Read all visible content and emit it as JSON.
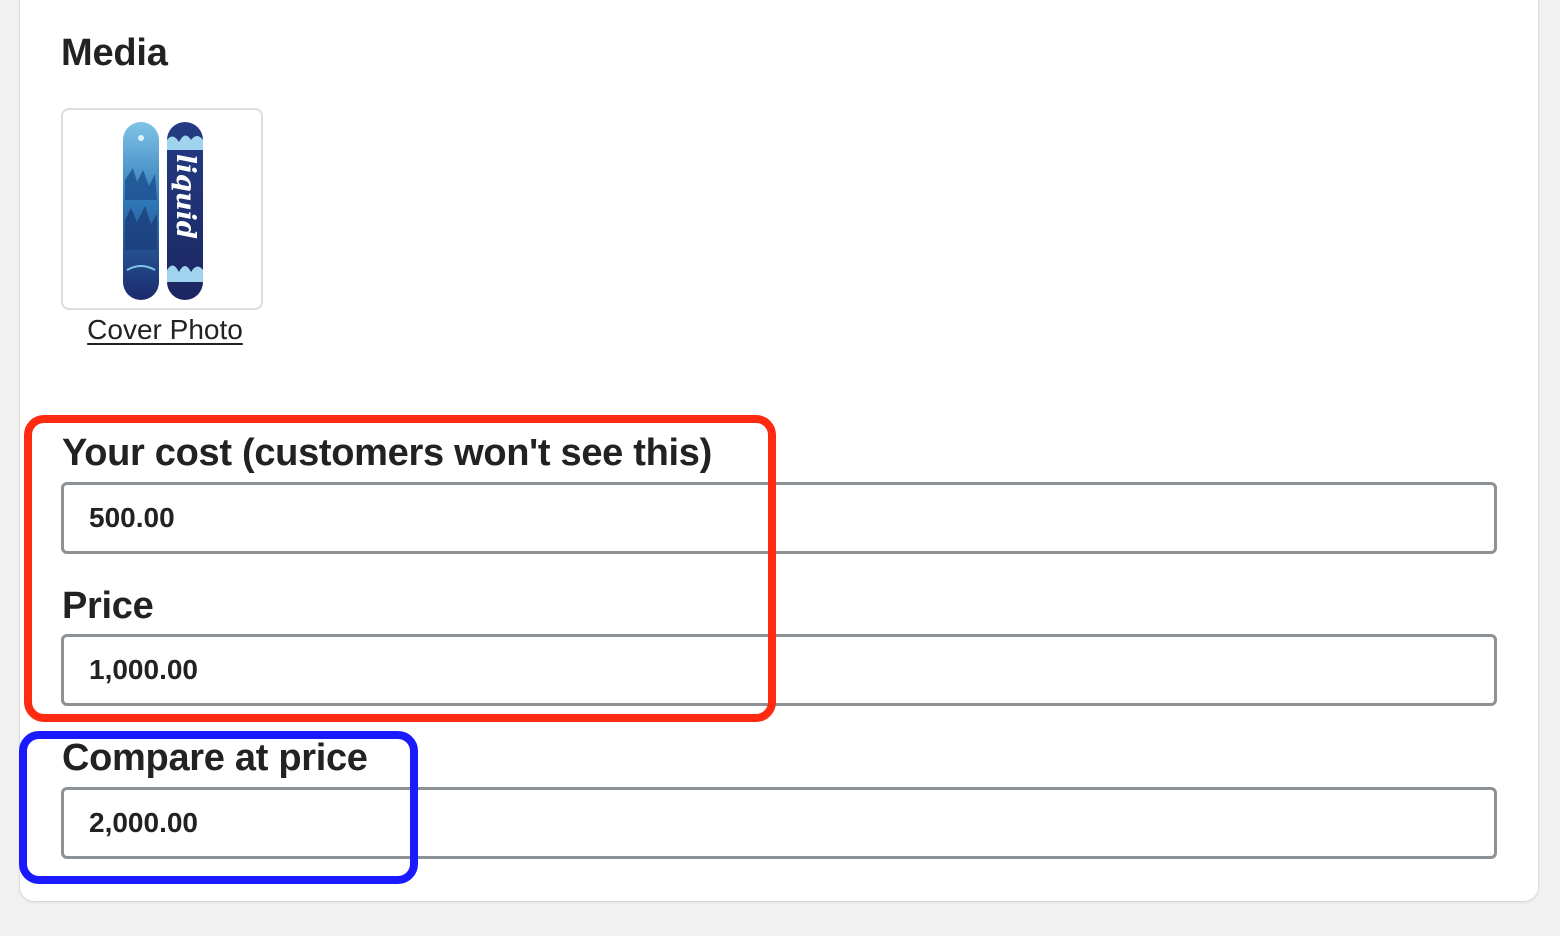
{
  "media": {
    "title": "Media",
    "cover_photo_label": "Cover Photo",
    "thumbnail_icon": "snowboard-image",
    "thumbnail_text": "liquid"
  },
  "fields": {
    "cost": {
      "label": "Your cost (customers won't see this)",
      "value": "500.00"
    },
    "price": {
      "label": "Price",
      "value": "1,000.00"
    },
    "compare_at_price": {
      "label": "Compare at price",
      "value": "2,000.00"
    }
  },
  "annotations": {
    "red_color": "#ff2a12",
    "blue_color": "#1a1aff"
  }
}
